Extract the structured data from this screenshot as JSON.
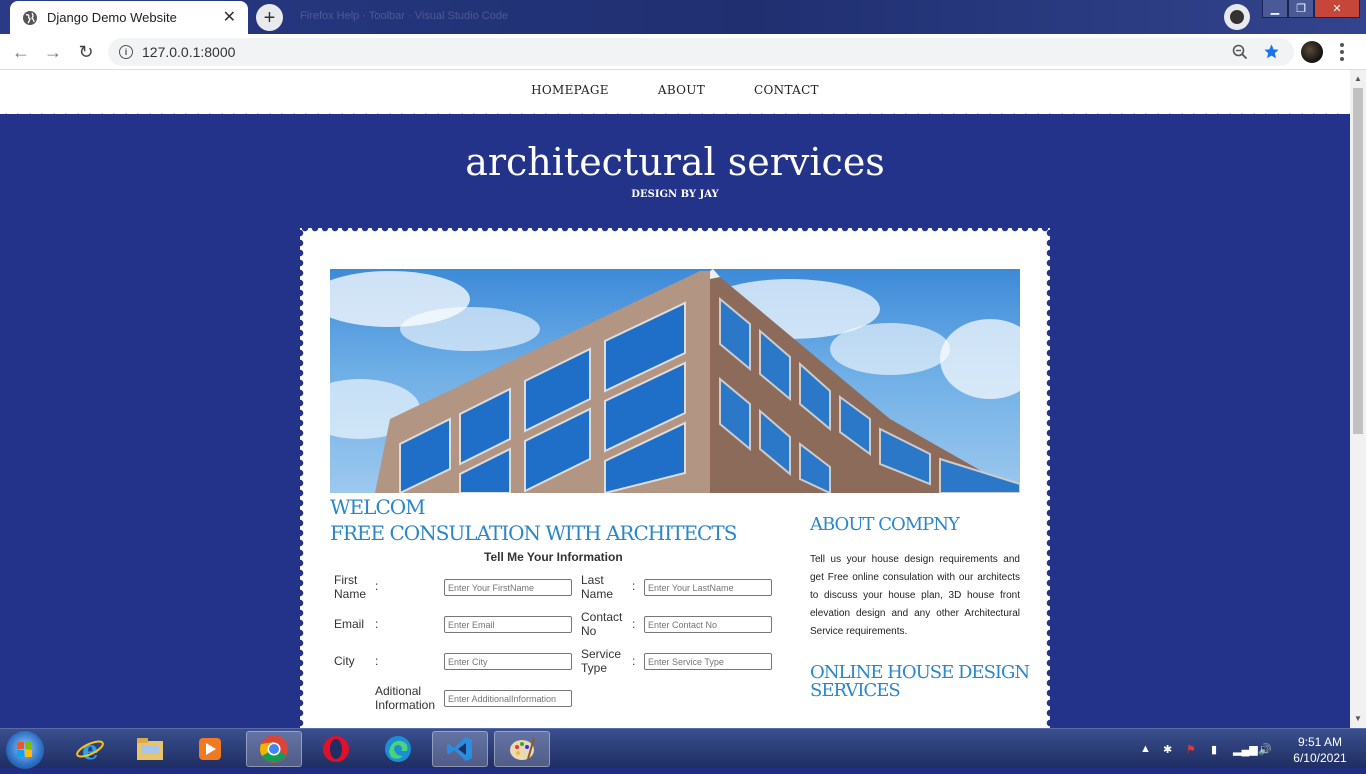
{
  "browser": {
    "tab_title": "Django Demo Website",
    "new_tab": "+",
    "close_tab": "✕",
    "url": "127.0.0.1:8000",
    "ghost_text": "Firefox   Help     ·    Toolbar   ·   Visual Studio Code"
  },
  "site": {
    "nav": [
      "HOMEPAGE",
      "ABOUT",
      "CONTACT"
    ],
    "hero_title": "architectural services",
    "hero_sub": "DESIGN BY JAY",
    "welcome": "WELCOM",
    "consult_heading": "FREE CONSULATION WITH ARCHITECTS",
    "form_title": "Tell Me Your Information",
    "form": {
      "first_name_label": "First Name",
      "first_name_ph": "Enter Your FirstName",
      "last_name_label": "Last Name",
      "last_name_ph": "Enter Your LastName",
      "email_label": "Email",
      "email_ph": "Enter Email",
      "contact_label": "Contact No",
      "contact_ph": "Enter Contact No",
      "city_label": "City",
      "city_ph": "Enter City",
      "service_label": "Service Type",
      "service_ph": "Enter Service Type",
      "additional_label": "Aditional Information",
      "additional_ph": "Enter AdditionalInformation",
      "colon": ":"
    },
    "about_heading": "ABOUT COMPNY",
    "about_text": "Tell us your house design requirements and get Free online consulation with our architects to discuss your house plan, 3D house front elevation design and any other Architectural Service requirements.",
    "online_heading": "ONLINE HOUSE DESIGN SERVICES"
  },
  "taskbar": {
    "time": "9:51 AM",
    "date": "6/10/2021"
  },
  "colors": {
    "page_bg": "#23338a",
    "heading_blue": "#2a86c8",
    "card_bg": "#ffffff"
  }
}
